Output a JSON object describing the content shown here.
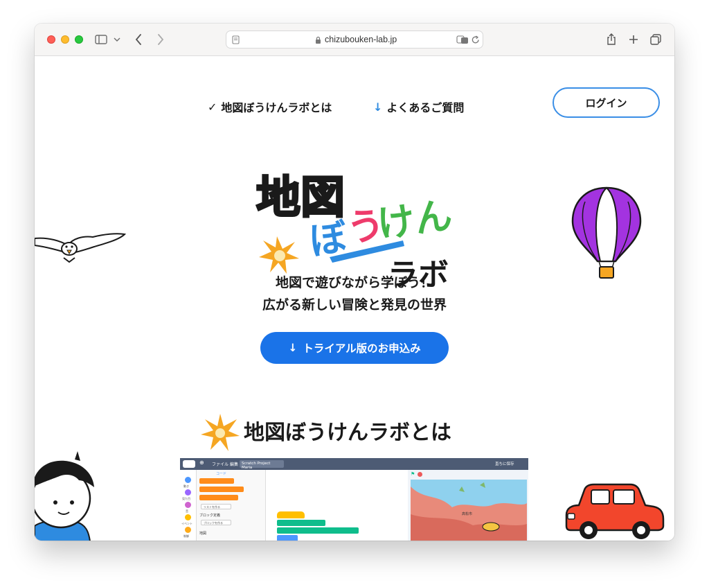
{
  "browser": {
    "url": "chizubouken-lab.jp",
    "back_icon": "chevron-left-icon",
    "forward_icon": "chevron-right-icon",
    "share_icon": "share-icon",
    "new_tab_icon": "plus-icon",
    "tabs_icon": "tabs-icon"
  },
  "nav": {
    "about_check": "✓",
    "about": "地図ぼうけんラボとは",
    "faq_arrow": "↓",
    "faq": "よくあるご質問",
    "login": "ログイン"
  },
  "hero": {
    "logo_text": "地図ぼうけんラボ",
    "tagline_line1": "地図で遊びながら学ぼう！",
    "tagline_line2": "広がる新しい冒険と発見の世界",
    "cta_arrow": "↓",
    "cta_label": "トライアル版のお申込み"
  },
  "section": {
    "title": "地図ぼうけんラボとは"
  },
  "screenshot": {
    "menu_file": "ファイル",
    "menu_edit": "編集",
    "project_title": "Scratch Project Maria",
    "save_now": "直ちに保存",
    "tab_code": "コード",
    "cat_motion": "動き",
    "cat_looks": "見た目",
    "cat_sound": "音",
    "cat_events": "イベント",
    "cat_control": "制御",
    "block_make_list": "リストを作る",
    "block_my_blocks": "ブロック定義",
    "block_make_block": "ブロックを作る",
    "block_map": "地図",
    "map_label": "高松市"
  },
  "colors": {
    "accent": "#1a73e8",
    "login_border": "#3a8ee6",
    "logo_pink": "#ee3b6b",
    "logo_green": "#43b649",
    "logo_blue": "#2e8be0"
  }
}
